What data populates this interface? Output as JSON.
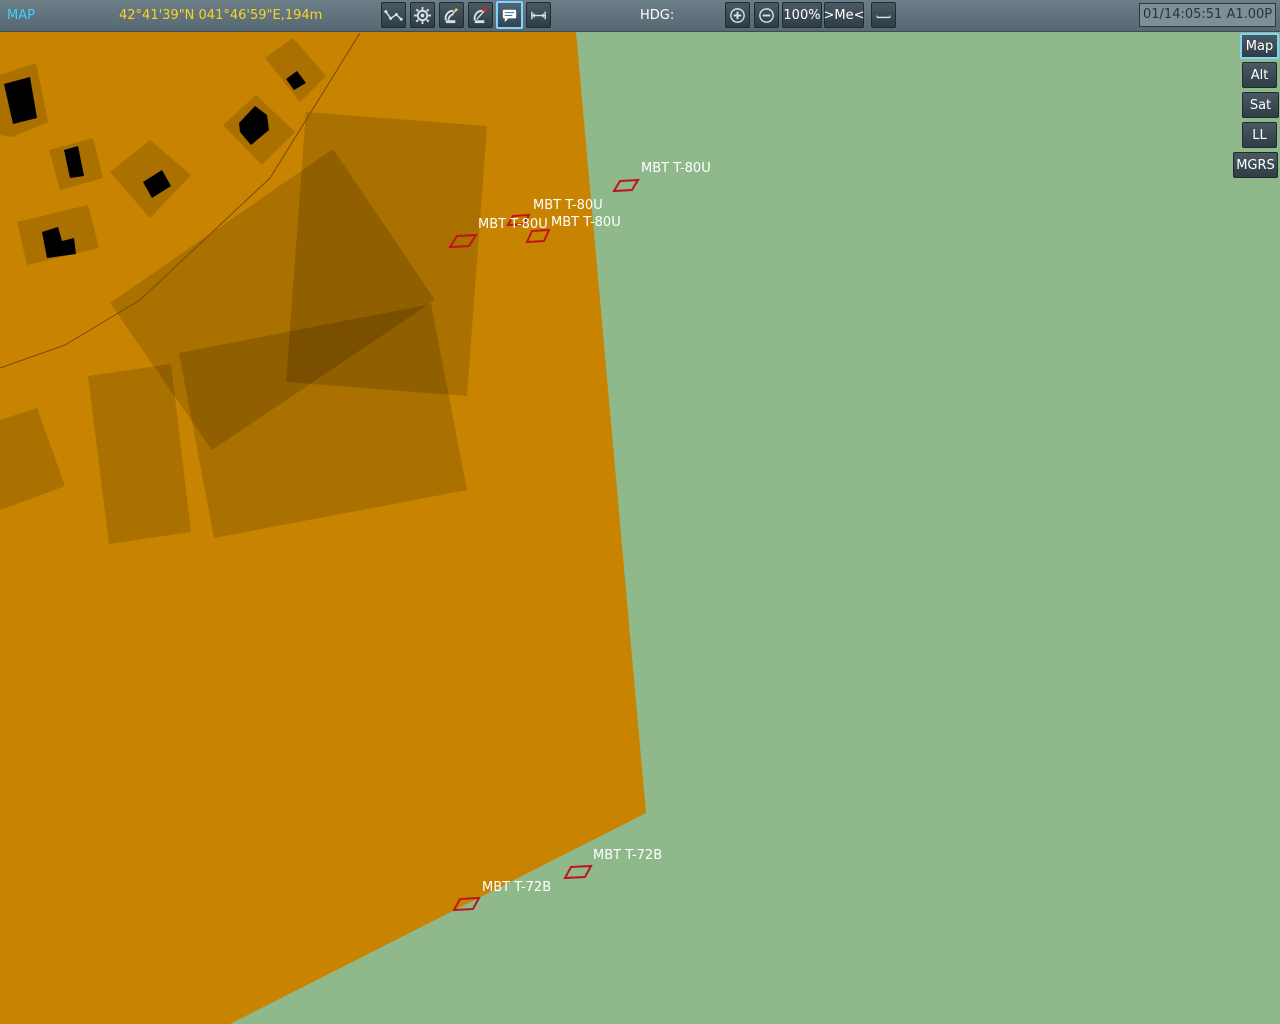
{
  "topbar": {
    "mode_label": "MAP",
    "coordinates": "42°41'39\"N 041°46'59\"E,194m",
    "heading_label": "HDG:",
    "zoom": "100%",
    "center_me": ">Me<",
    "clock": "01/14:05:51 A1.00P"
  },
  "tools": [
    {
      "name": "route-tool",
      "icon": "waypoints-icon"
    },
    {
      "name": "gear-tool",
      "icon": "gear-icon"
    },
    {
      "name": "radar-tool",
      "icon": "radar-icon"
    },
    {
      "name": "radar-off-tool",
      "icon": "radar-off-icon"
    },
    {
      "name": "labels-tool",
      "icon": "message-icon",
      "active": true
    },
    {
      "name": "ruler-tool",
      "icon": "ruler-icon"
    }
  ],
  "side_buttons": {
    "map": "Map",
    "alt": "Alt",
    "sat": "Sat",
    "ll": "LL",
    "mgrs": "MGRS"
  },
  "colors": {
    "grass": "#8fb98a",
    "urban": "#c88400",
    "building": "#000000",
    "unit_marker": "#c0141c"
  },
  "units": [
    {
      "label": "MBT T-80U"
    },
    {
      "label": "MBT T-80U"
    },
    {
      "label": "MBT T-80U"
    },
    {
      "label": "MBT T-80U"
    },
    {
      "label": "MBT T-72B"
    },
    {
      "label": "MBT T-72B"
    }
  ]
}
